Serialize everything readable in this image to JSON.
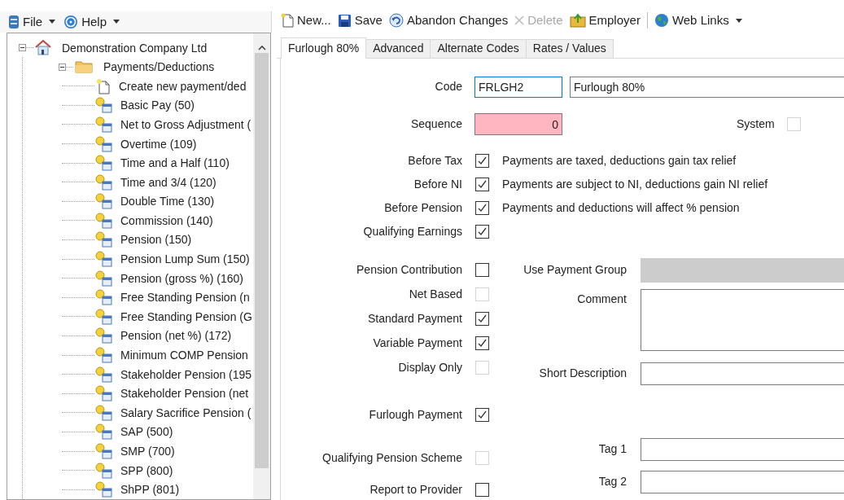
{
  "menu": [
    {
      "label": "File",
      "kind": "file"
    },
    {
      "label": "Help",
      "kind": "help"
    }
  ],
  "tree": {
    "label": "Demonstration Company Ltd",
    "kind": "company",
    "expanded": true,
    "children": [
      {
        "label": "Payments/Deductions",
        "kind": "folder",
        "expanded": true,
        "children": [
          {
            "label": "Create new payment/ded",
            "kind": "new"
          },
          {
            "label": "Basic Pay (50)",
            "kind": "item"
          },
          {
            "label": "Net to Gross Adjustment (",
            "kind": "item"
          },
          {
            "label": "Overtime (109)",
            "kind": "item"
          },
          {
            "label": "Time and a Half (110)",
            "kind": "item"
          },
          {
            "label": "Time and 3/4 (120)",
            "kind": "item"
          },
          {
            "label": "Double Time (130)",
            "kind": "item"
          },
          {
            "label": "Commission (140)",
            "kind": "item"
          },
          {
            "label": "Pension (150)",
            "kind": "item"
          },
          {
            "label": "Pension Lump Sum (150)",
            "kind": "item"
          },
          {
            "label": "Pension (gross %) (160)",
            "kind": "item"
          },
          {
            "label": "Free Standing Pension (n",
            "kind": "item"
          },
          {
            "label": "Free Standing Pension (G",
            "kind": "item"
          },
          {
            "label": "Pension (net %) (172)",
            "kind": "item"
          },
          {
            "label": "Minimum COMP Pension",
            "kind": "item"
          },
          {
            "label": "Stakeholder Pension (195",
            "kind": "item"
          },
          {
            "label": "Stakeholder Pension (net",
            "kind": "item"
          },
          {
            "label": "Salary Sacrifice Pension (",
            "kind": "item"
          },
          {
            "label": "SAP (500)",
            "kind": "item"
          },
          {
            "label": "SMP (700)",
            "kind": "item"
          },
          {
            "label": "SPP (800)",
            "kind": "item"
          },
          {
            "label": "ShPP (801)",
            "kind": "item"
          }
        ]
      }
    ]
  },
  "toolbar": [
    {
      "label": "New...",
      "kind": "new",
      "disabled": false,
      "has_menu": false
    },
    {
      "label": "Save",
      "kind": "save",
      "disabled": false,
      "has_menu": false
    },
    {
      "label": "Abandon Changes",
      "kind": "undo",
      "disabled": false,
      "has_menu": false
    },
    {
      "label": "Delete",
      "kind": "delete",
      "disabled": true,
      "has_menu": false
    },
    {
      "label": "Employer",
      "kind": "employer",
      "disabled": false,
      "has_menu": false
    },
    {
      "kind": "separator"
    },
    {
      "label": "Web Links",
      "kind": "globe",
      "disabled": false,
      "has_menu": true
    }
  ],
  "tabs": [
    {
      "label": "Furlough 80%",
      "selected": true
    },
    {
      "label": "Advanced",
      "selected": false
    },
    {
      "label": "Alternate Codes",
      "selected": false
    },
    {
      "label": "Rates / Values",
      "selected": false
    }
  ],
  "code": {
    "label": "Code",
    "value": "FRLGH2",
    "focused": true
  },
  "name": {
    "value": "Furlough 80%"
  },
  "sequence": {
    "label": "Sequence",
    "value": "0",
    "invalid": true
  },
  "system": {
    "label": "System",
    "checked": false,
    "disabled": true
  },
  "tax_flags": [
    {
      "label": "Before Tax",
      "checked": true,
      "disabled": false,
      "note": "Payments are taxed, deductions gain tax relief"
    },
    {
      "label": "Before NI",
      "checked": true,
      "disabled": false,
      "note": "Payments are subject to NI, deductions gain NI relief"
    },
    {
      "label": "Before Pension",
      "checked": true,
      "disabled": false,
      "note": "Payments and deductions will affect % pension"
    },
    {
      "label": "Qualifying Earnings",
      "checked": true,
      "disabled": false
    }
  ],
  "options": [
    {
      "label": "Pension Contribution",
      "checked": false,
      "disabled": false
    },
    {
      "label": "Net Based",
      "checked": false,
      "disabled": true
    },
    {
      "label": "Standard Payment",
      "checked": true,
      "disabled": false
    },
    {
      "label": "Variable Payment",
      "checked": true,
      "disabled": false
    },
    {
      "label": "Display Only",
      "checked": false,
      "disabled": true
    }
  ],
  "furlough": {
    "label": "Furlough Payment",
    "checked": true,
    "disabled": false
  },
  "scheme_flags": [
    {
      "label": "Qualifying Pension Scheme",
      "checked": false,
      "disabled": true
    },
    {
      "label": "Report to Provider",
      "checked": false,
      "disabled": false
    }
  ],
  "payment_group": {
    "label": "Use Payment Group",
    "disabled": true
  },
  "comment": {
    "label": "Comment"
  },
  "short_description": {
    "label": "Short Description"
  },
  "tags": [
    {
      "label": "Tag 1"
    },
    {
      "label": "Tag 2"
    }
  ]
}
